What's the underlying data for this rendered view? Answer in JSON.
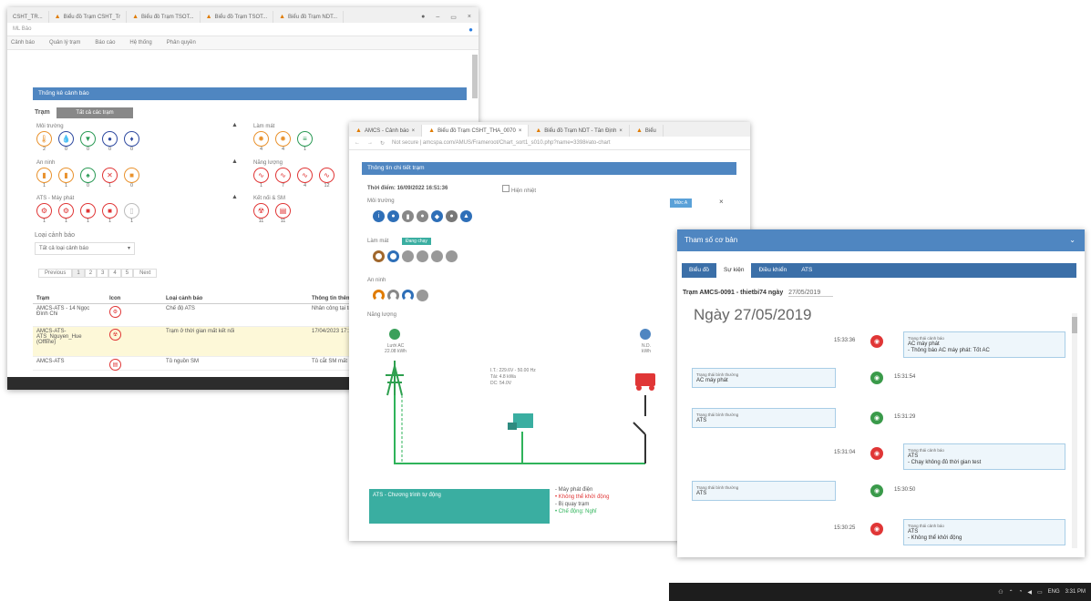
{
  "win1": {
    "tabs": [
      "CSHT_TR...",
      "Biểu đồ Trạm CSHT_Tr",
      "Biểu đồ Trạm TSOT...",
      "Biểu đồ Trạm TSOT...",
      "Biểu đồ Trạm NDT..."
    ],
    "address": "ML Bảo",
    "menu": [
      "Cảnh báo",
      "Quản lý trạm",
      "Báo cáo",
      "Hệ thống",
      "Phân quyền"
    ],
    "panel_title": "Thống kê cảnh báo",
    "filter_label": "Trạm",
    "filter_button": "Tất cả các trạm",
    "groups": [
      {
        "label": "Môi trường",
        "counts": [
          "2",
          "0",
          "0",
          "0",
          "0"
        ]
      },
      {
        "label": "An ninh",
        "counts": [
          "1",
          "1",
          "0",
          "1",
          "0"
        ]
      },
      {
        "label": "ATS - Máy phát",
        "counts": [
          "1",
          "1",
          "1",
          "1",
          "1"
        ]
      },
      {
        "label": "Làm mát",
        "counts": [
          "4",
          "4",
          "1"
        ]
      },
      {
        "label": "Năng lượng",
        "counts": [
          "1",
          "7",
          "4",
          "12"
        ]
      },
      {
        "label": "Kết nối & SM",
        "counts": [
          "11",
          "11"
        ]
      }
    ],
    "type_label": "Loại cảnh báo",
    "type_select": "Tất cả loại cảnh báo",
    "pagination": [
      "Previous",
      "1",
      "2",
      "3",
      "4",
      "5",
      "Next"
    ],
    "table_headers": [
      "Trạm",
      "Icon",
      "Loại cảnh báo",
      "Thông tin thêm"
    ],
    "table_rows": [
      {
        "station": "AMCS-ATS - 14 Ngọc Đình Chi",
        "type": "Chế độ ATS",
        "info": "Nhân công tại trạm"
      },
      {
        "station": "AMCS-ATS-ATS_Nguyen_Hue (Offline)",
        "type": "Trạm ở thời gian mất kết nối",
        "info": "17/04/2023 17:17"
      },
      {
        "station": "AMCS-ATS",
        "type": "Tủ nguồn SM",
        "info": "Tủ cắt SM mất"
      }
    ]
  },
  "win2": {
    "tabs": [
      "AMCS - Cảnh báo",
      "Biểu đồ Trạm CSHT_THA_0070",
      "Biểu đồ Trạm NDT - Tân Định",
      "Biểu"
    ],
    "address": "Not secure | amcspa.com/AMUS/Frameroot/Chart_sort1_s010.php?name=3398#ato-chart",
    "panel_title": "Thông tin chi tiết trạm",
    "status_line": "Thời điểm: 16/09/2022 16:51:36",
    "status_check": "Hiện nhiệt",
    "sections": [
      "Môi trường",
      "Làm mát",
      "An ninh",
      "Năng lượng"
    ],
    "cool_badge": "Đang chạy",
    "badge": "Mức A",
    "source_left": "Lưới AC 22.08 kWh",
    "source_right": "N.D. kWh",
    "center_info": [
      "I.T.: 229.6V - 50.00 Hz",
      "Tải: 4.8 kWa",
      "DC: 54.0V"
    ],
    "teal_box": "ATS - Chương trình tự động",
    "legend": [
      "- Máy phát điện",
      "• Không thể khởi động",
      "- Bị quạy trạm",
      "• Chế động: Nghỉ"
    ]
  },
  "win3": {
    "title": "Tham số cơ bản",
    "tabs": [
      "Biểu đồ",
      "Sự kiện",
      "Điều khiển",
      "ATS"
    ],
    "station": "Trạm AMCS-0091 - thietbi74 ngày",
    "date_field": "27/05/2019",
    "day": "Ngày 27/05/2019",
    "events": [
      {
        "time": "15:33:36",
        "side": "right",
        "color": "#e03636",
        "head": "Trạng thái cảnh báo",
        "line1": "AC máy phát",
        "line2": "- Thông báo AC máy phát: Tốt AC"
      },
      {
        "time": "15:31:54",
        "side": "left",
        "color": "#3a9a4a",
        "head": "Trạng thái bình thường",
        "line1": "AC máy phát",
        "line2": ""
      },
      {
        "time": "15:31:29",
        "side": "left",
        "color": "#3a9a4a",
        "head": "Trạng thái bình thường",
        "line1": "ATS",
        "line2": ""
      },
      {
        "time": "15:31:04",
        "side": "right",
        "color": "#e03636",
        "head": "Trạng thái cảnh báo",
        "line1": "ATS",
        "line2": "- Chạy không đủ thời gian test"
      },
      {
        "time": "15:30:50",
        "side": "left",
        "color": "#3a9a4a",
        "head": "Trạng thái bình thường",
        "line1": "ATS",
        "line2": ""
      },
      {
        "time": "15:30:25",
        "side": "right",
        "color": "#e03636",
        "head": "Trạng thái cảnh báo",
        "line1": "ATS",
        "line2": "- Không thể khởi động"
      }
    ]
  },
  "taskbar": {
    "lang": "ENG",
    "time": "3:31 PM"
  }
}
